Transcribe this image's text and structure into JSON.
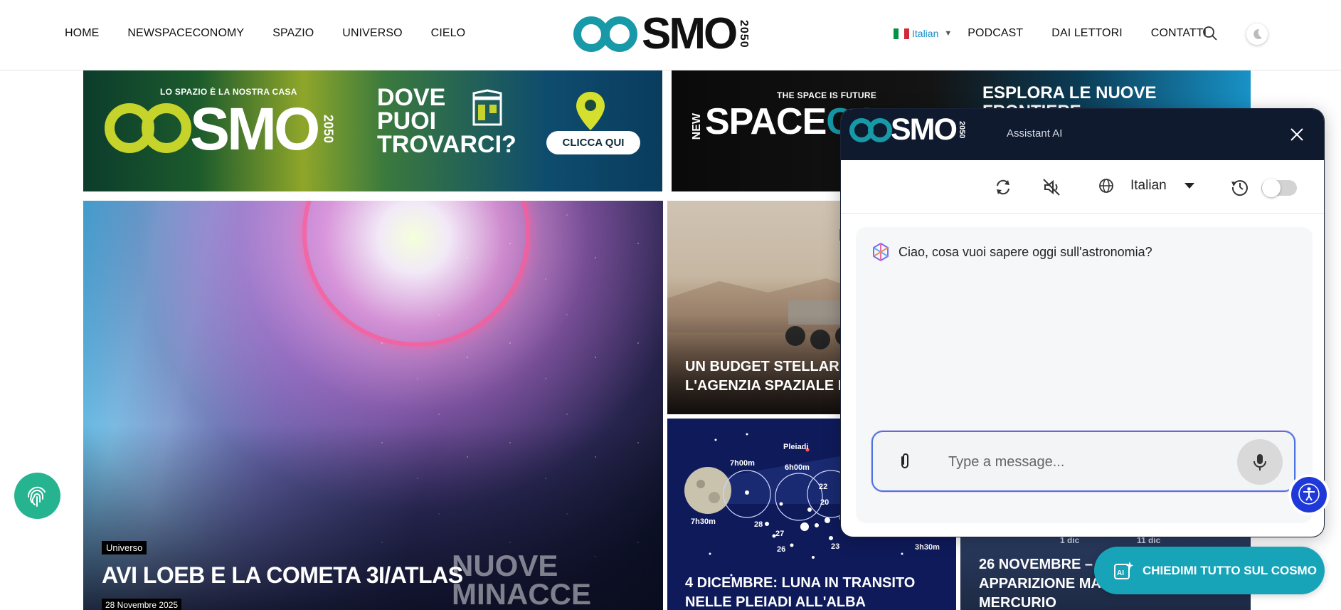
{
  "header": {
    "nav_left": [
      "HOME",
      "NEWSPACECONOMY",
      "SPAZIO",
      "UNIVERSO",
      "CIELO"
    ],
    "logo": {
      "word": "SMO",
      "year": "2050"
    },
    "language": "Italian",
    "nav_right": [
      "PODCAST",
      "DAI LETTORI",
      "CONTATTI"
    ]
  },
  "banners": {
    "left": {
      "tagline": "LO SPAZIO È LA NOSTRA CASA",
      "logo_word": "SMO",
      "logo_year": "2050",
      "headline": "DOVE\nPUOI\nTROVARCI?",
      "button": "CLICCA QUI"
    },
    "right": {
      "tagline": "THE SPACE IS FUTURE",
      "new_label": "NEW",
      "space_word": "SPACE",
      "space_accent": "CO",
      "headline": "ESPLORA LE NUOVE",
      "headline_2": "FRONTIERE"
    }
  },
  "hero": {
    "category": "Universo",
    "title": "AVI LOEB E LA COMETA 3I/ATLAS",
    "date": "28 Novembre 2025",
    "overlay_text": "NUOVE MINACCE\nPER L'OZONO"
  },
  "cards": [
    {
      "title": "UN BUDGET STELLARE\nL'AGENZIA SPAZIALE E"
    },
    {
      "title": "4 DICEMBRE: LUNA IN TRANSITO\nNELLE PLEIADI ALL'ALBA",
      "chart_labels": {
        "pleiadi": "Pleiadi",
        "t1": "7h00m",
        "t2": "6h00m",
        "t3": "7h30m",
        "t4": "3h30m",
        "n": [
          "22",
          "20",
          "28",
          "27",
          "26",
          "23"
        ]
      }
    },
    {
      "title": "26 NOVEMBRE –\nAPPARIZIONE MA\nMERCURIO",
      "dates": [
        "1 dic",
        "11 dic"
      ]
    }
  ],
  "chat": {
    "logo_word": "SMO",
    "logo_year": "2050",
    "subtitle": "Assistant AI",
    "language": "Italian",
    "greeting": "Ciao, cosa vuoi sapere oggi sull'astronomia?",
    "input_placeholder": "Type a message..."
  },
  "ask_button": "CHIEDIMI TUTTO SUL COSMO",
  "colors": {
    "brand_teal": "#1799a8",
    "brand_lime": "#c6d32a",
    "chat_header": "#0f1a2e",
    "accessibility_blue": "#1f39d8",
    "fingerprint_green": "#26b38f"
  }
}
